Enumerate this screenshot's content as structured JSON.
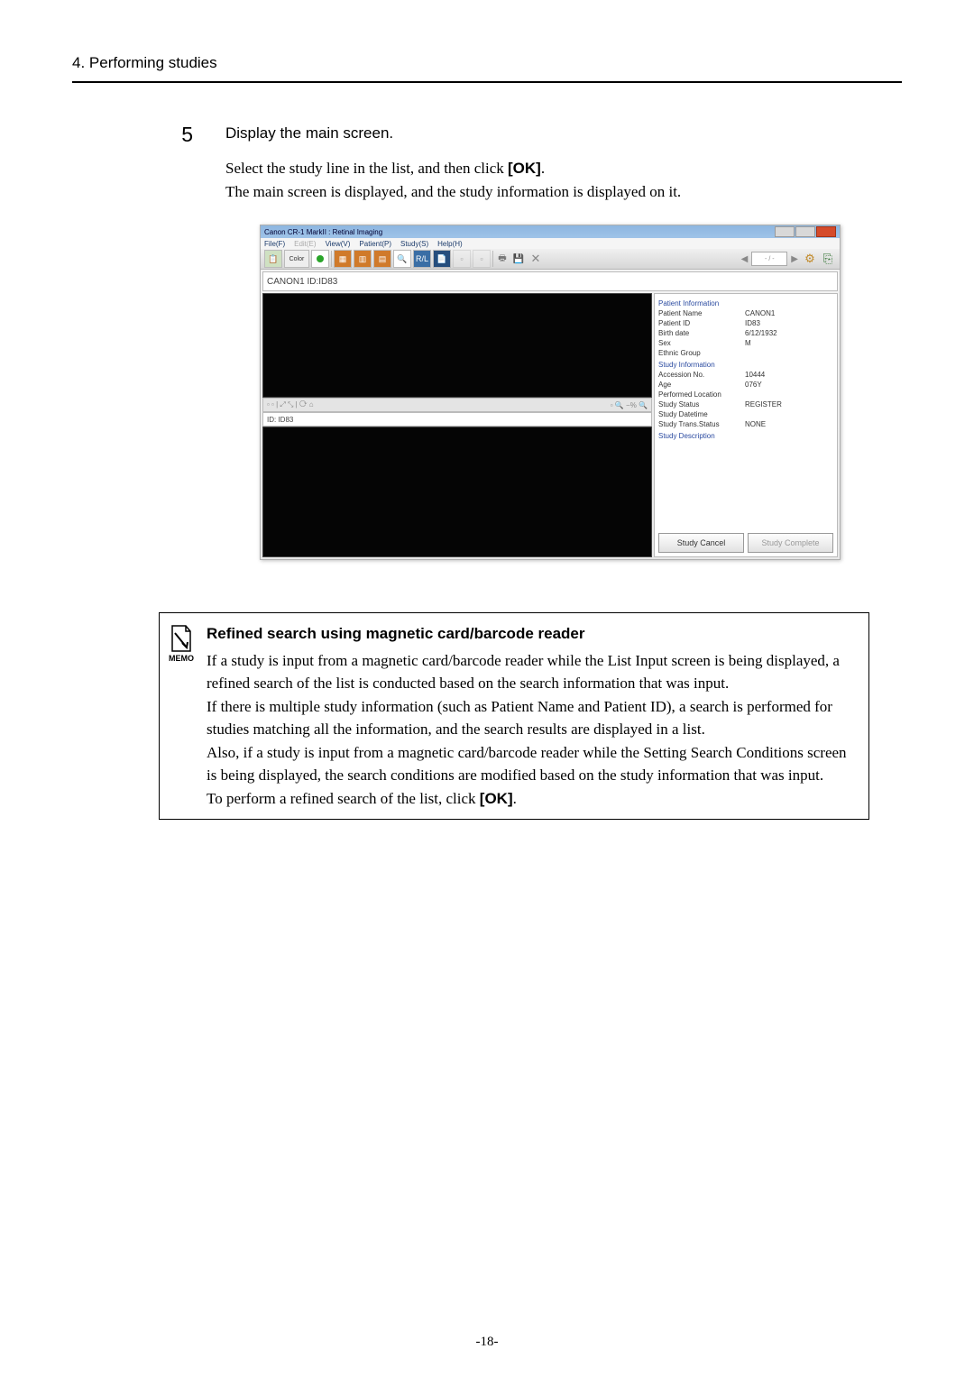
{
  "heading": "4. Performing studies",
  "step": {
    "number": "5",
    "title": "Display the main screen.",
    "line1_a": "Select the study line in the list, and then click ",
    "ok_label": "[OK]",
    "line1_b": ".",
    "line2": "The main screen is displayed, and the study information is displayed on it."
  },
  "window": {
    "title": "Canon CR-1 MarkII : Retinal Imaging",
    "menu": [
      "File(F)",
      "Edit(E)",
      "View(V)",
      "Patient(P)",
      "Study(S)",
      "Help(H)"
    ],
    "id_bar": "CANON1 ID:ID83",
    "thumb_id": "ID: ID83",
    "nav_text": "- / -",
    "color_label": "Color",
    "patient_section": "Patient Information",
    "study_section": "Study Information",
    "study_desc_section": "Study Description",
    "patient": {
      "name_k": "Patient Name",
      "name_v": "CANON1",
      "id_k": "Patient ID",
      "id_v": "ID83",
      "birth_k": "Birth date",
      "birth_v": "6/12/1932",
      "sex_k": "Sex",
      "sex_v": "M",
      "ethnic_k": "Ethnic Group",
      "ethnic_v": ""
    },
    "study": {
      "acc_k": "Accession No.",
      "acc_v": "10444",
      "age_k": "Age",
      "age_v": "076Y",
      "loc_k": "Performed Location",
      "loc_v": "",
      "status_k": "Study Status",
      "status_v": "REGISTER",
      "dt_k": "Study Datetime",
      "dt_v": "",
      "trans_k": "Study Trans.Status",
      "trans_v": "NONE"
    },
    "btn_cancel": "Study Cancel",
    "btn_complete": "Study Complete"
  },
  "memo": {
    "label": "MEMO",
    "title": "Refined search using magnetic card/barcode reader",
    "p1": "If a study is input from a magnetic card/barcode reader while the List Input screen is being displayed, a refined search of the list is conducted based on the search information that was input.",
    "p2": "If there is multiple study information (such as Patient Name and Patient ID), a search is performed for studies matching all the information, and the search results are displayed in a list.",
    "p3": "Also, if a study is input from a magnetic card/barcode reader while the Setting Search Conditions screen is being displayed, the search conditions are modified based on the study information that was input.",
    "p4a": "To perform a refined search of the list, click ",
    "p4b": "."
  },
  "page_number": "-18-"
}
